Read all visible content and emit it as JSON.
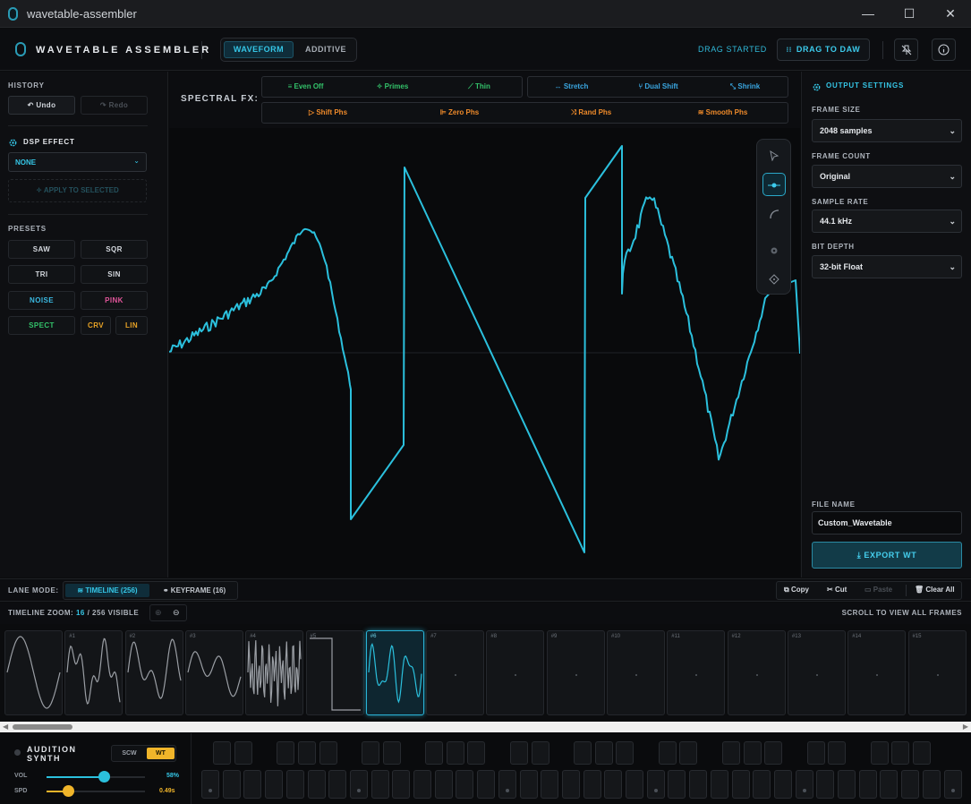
{
  "window": {
    "title": "wavetable-assembler",
    "minimize": "—",
    "maximize": "☐",
    "close": "✕"
  },
  "header": {
    "brand": "WAVETABLE ASSEMBLER",
    "tabs": [
      {
        "label": "WAVEFORM",
        "active": true
      },
      {
        "label": "ADDITIVE",
        "active": false
      }
    ],
    "drag_status": "DRAG STARTED",
    "drag_button": "DRAG TO DAW",
    "drag_icon": "grip-icon",
    "pin_icon": "pin-off-icon",
    "info_icon": "info-icon"
  },
  "left": {
    "history_label": "HISTORY",
    "undo": "Undo",
    "redo": "Redo",
    "dsp_label": "DSP EFFECT",
    "dsp_value": "NONE",
    "apply_label": "APPLY TO SELECTED",
    "presets_label": "PRESETS",
    "presets": [
      {
        "label": "SAW",
        "color": "#d4d8de"
      },
      {
        "label": "SQR",
        "color": "#d4d8de"
      },
      {
        "label": "TRI",
        "color": "#d4d8de"
      },
      {
        "label": "SIN",
        "color": "#d4d8de"
      },
      {
        "label": "NOISE",
        "color": "#3ab8e0"
      },
      {
        "label": "PINK",
        "color": "#e0559a"
      },
      {
        "label": "SPECT",
        "color": "#33c26a"
      },
      {
        "label": "CRV",
        "color": "#e8a326"
      },
      {
        "label": "LIN",
        "color": "#e8a326"
      }
    ]
  },
  "fx": {
    "label": "SPECTRAL FX:",
    "row1a": [
      {
        "label": "Even Off",
        "color": "#33c26a"
      },
      {
        "label": "Primes",
        "color": "#33c26a"
      },
      {
        "label": "Thin",
        "color": "#33c26a"
      }
    ],
    "row1b": [
      {
        "label": "Stretch",
        "color": "#3aa6e0"
      },
      {
        "label": "Dual Shift",
        "color": "#3aa6e0"
      },
      {
        "label": "Shrink",
        "color": "#3aa6e0"
      }
    ],
    "row2": [
      {
        "label": "Shift Phs",
        "color": "#ee8a2a"
      },
      {
        "label": "Zero Phs",
        "color": "#ee8a2a"
      },
      {
        "label": "Rand Phs",
        "color": "#ee8a2a"
      },
      {
        "label": "Smooth Phs",
        "color": "#ee8a2a"
      }
    ]
  },
  "tools": [
    "select-tool-icon",
    "node-tool-icon",
    "curve-tool-icon",
    "gear-tool-icon",
    "pen-tool-icon"
  ],
  "right": {
    "title": "OUTPUT SETTINGS",
    "frame_size_label": "FRAME SIZE",
    "frame_size": "2048 samples",
    "frame_count_label": "FRAME COUNT",
    "frame_count": "Original",
    "sample_rate_label": "SAMPLE RATE",
    "sample_rate": "44.1 kHz",
    "bit_depth_label": "BIT DEPTH",
    "bit_depth": "32-bit Float",
    "file_name_label": "FILE NAME",
    "file_name": "Custom_Wavetable",
    "export": "EXPORT WT"
  },
  "lane": {
    "label": "LANE MODE:",
    "timeline": "TIMELINE (256)",
    "keyframe": "KEYFRAME (16)",
    "copy": "Copy",
    "cut": "Cut",
    "paste": "Paste",
    "clear": "Clear All"
  },
  "zoom": {
    "label": "TIMELINE ZOOM:",
    "value": "16",
    "suffix": "/ 256 VISIBLE",
    "hint": "SCROLL TO VIEW ALL FRAMES"
  },
  "frames": [
    "",
    "#1",
    "#2",
    "#3",
    "#4",
    "#5",
    "#6",
    "#7",
    "#8",
    "#9",
    "#10",
    "#11",
    "#12",
    "#13",
    "#14",
    "#15"
  ],
  "active_frame": 6,
  "synth": {
    "title": "AUDITION SYNTH",
    "mode_scw": "SCW",
    "mode_wt": "WT",
    "vol_label": "VOL",
    "vol_value": "58%",
    "vol_level": 0.58,
    "spd_label": "SPD",
    "spd_value": "0.49s",
    "spd_level": 0.22
  }
}
